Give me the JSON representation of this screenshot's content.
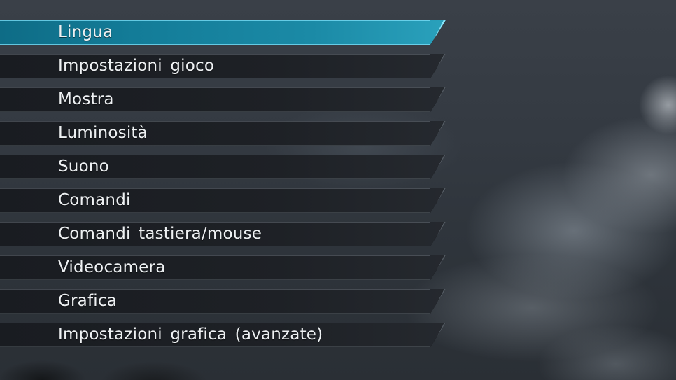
{
  "menu": {
    "selected_index": 0,
    "accent_color": "#137c98",
    "items": [
      {
        "label": "Lingua"
      },
      {
        "label": "Impostazioni gioco"
      },
      {
        "label": "Mostra"
      },
      {
        "label": "Luminosità"
      },
      {
        "label": "Suono"
      },
      {
        "label": "Comandi"
      },
      {
        "label": "Comandi tastiera/mouse"
      },
      {
        "label": "Videocamera"
      },
      {
        "label": "Grafica"
      },
      {
        "label": "Impostazioni grafica (avanzate)"
      }
    ]
  }
}
